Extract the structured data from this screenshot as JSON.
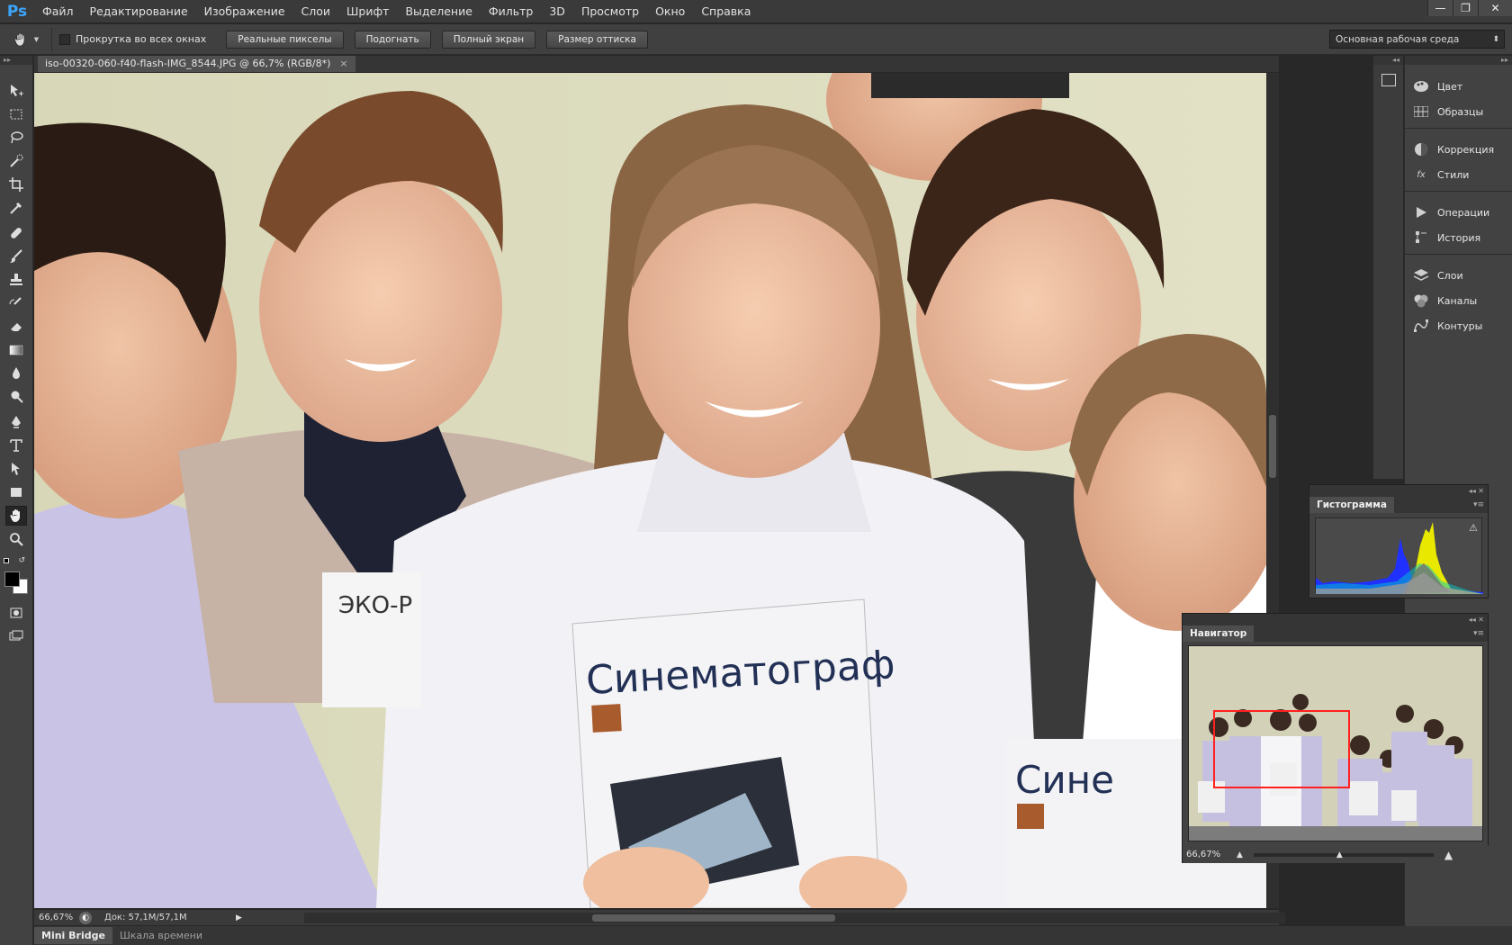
{
  "app": {
    "logo": "Ps"
  },
  "menu": [
    "Файл",
    "Редактирование",
    "Изображение",
    "Слои",
    "Шрифт",
    "Выделение",
    "Фильтр",
    "3D",
    "Просмотр",
    "Окно",
    "Справка"
  ],
  "window_controls": {
    "minimize": "—",
    "restore": "❐",
    "close": "✕"
  },
  "options": {
    "scroll_all_label": "Прокрутка во всех окнах",
    "buttons": [
      "Реальные пикселы",
      "Подогнать",
      "Полный экран",
      "Размер оттиска"
    ],
    "workspace": "Основная рабочая среда"
  },
  "document": {
    "tab_title": "iso-00320-060-f40-flash-IMG_8544.JPG @ 66,7% (RGB/8*)",
    "close_glyph": "×",
    "box_text_main": "Синематограф",
    "box_text_right": "Сине",
    "box_text_left": "ЭКО-Р"
  },
  "status": {
    "zoom": "66,67%",
    "doc": "Док: 57,1M/57,1M"
  },
  "bottom_tabs": [
    "Mini Bridge",
    "Шкала времени"
  ],
  "dock": {
    "items": [
      "Цвет",
      "Образцы",
      "Коррекция",
      "Стили",
      "Операции",
      "История",
      "Слои",
      "Каналы",
      "Контуры"
    ],
    "icons": [
      "palette-icon",
      "swatches-icon",
      "adjustments-icon",
      "styles-icon",
      "actions-icon",
      "history-icon",
      "layers-icon",
      "channels-icon",
      "paths-icon"
    ]
  },
  "histogram": {
    "title": "Гистограмма",
    "warning": "⚠"
  },
  "navigator": {
    "title": "Навигатор",
    "zoom": "66,67%"
  },
  "tools": [
    "move-tool-icon",
    "marquee-tool-icon",
    "lasso-tool-icon",
    "quick-select-tool-icon",
    "crop-tool-icon",
    "eyedropper-tool-icon",
    "healing-brush-tool-icon",
    "brush-tool-icon",
    "clone-stamp-tool-icon",
    "history-brush-tool-icon",
    "eraser-tool-icon",
    "gradient-tool-icon",
    "blur-tool-icon",
    "dodge-tool-icon",
    "pen-tool-icon",
    "type-tool-icon",
    "path-select-tool-icon",
    "rectangle-tool-icon",
    "hand-tool-icon",
    "zoom-tool-icon"
  ]
}
